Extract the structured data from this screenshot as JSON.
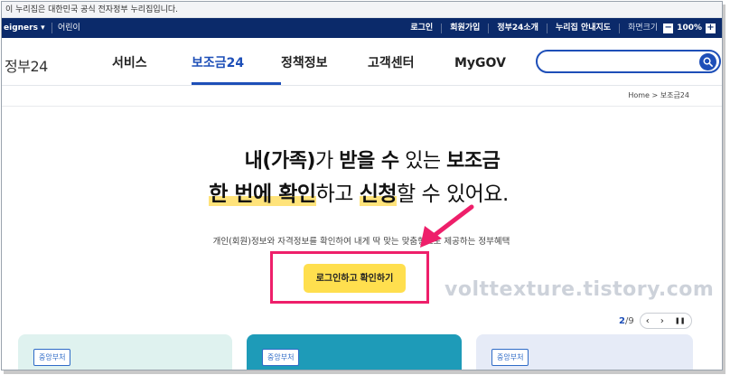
{
  "gov_banner": "이 누리집은 대한민국 공식 전자정부 누리집입니다.",
  "utility": {
    "lang": "eigners ▾",
    "kids": "어린이",
    "links": [
      "로그인",
      "회원가입",
      "정부24소개",
      "누리집 안내지도"
    ],
    "zoom_label": "화면크기",
    "zoom_minus": "−",
    "zoom_value": "100%",
    "zoom_plus": "+"
  },
  "header": {
    "logo": "정부24",
    "nav": [
      "서비스",
      "보조금24",
      "정책정보",
      "고객센터",
      "MyGOV"
    ],
    "active_nav": "보조금24",
    "search_placeholder": ""
  },
  "breadcrumb": "Home > 보조금24",
  "hero": {
    "l1_a": "내(가족)",
    "l1_b": "가 ",
    "l1_c": "받을 수",
    "l1_d": " 있는 ",
    "l1_e": "보조금",
    "l2_a": "한 번에 확인",
    "l2_b": "하고 ",
    "l2_c": "신청",
    "l2_d": "할 수 있어요."
  },
  "subtext": "개인(회원)정보와 자격정보를 확인하여 내게 딱 맞는 맞춤형으로 제공하는 정부혜택",
  "cta_label": "로그인하고 확인하기",
  "watermark": "volttexture.tistory.com",
  "pager": {
    "current": "2",
    "sep": "/",
    "total": "9",
    "prev": "‹",
    "next": "›",
    "pause": "❚❚"
  },
  "cards": [
    {
      "tag": "중앙부처"
    },
    {
      "tag": "중앙부처"
    },
    {
      "tag": "중앙부처"
    }
  ],
  "colors": {
    "navy": "#0b2a6a",
    "brand_blue": "#1e4fb8",
    "cta_yellow": "#ffdf4e",
    "annotation_pink": "#ee1f6a"
  }
}
